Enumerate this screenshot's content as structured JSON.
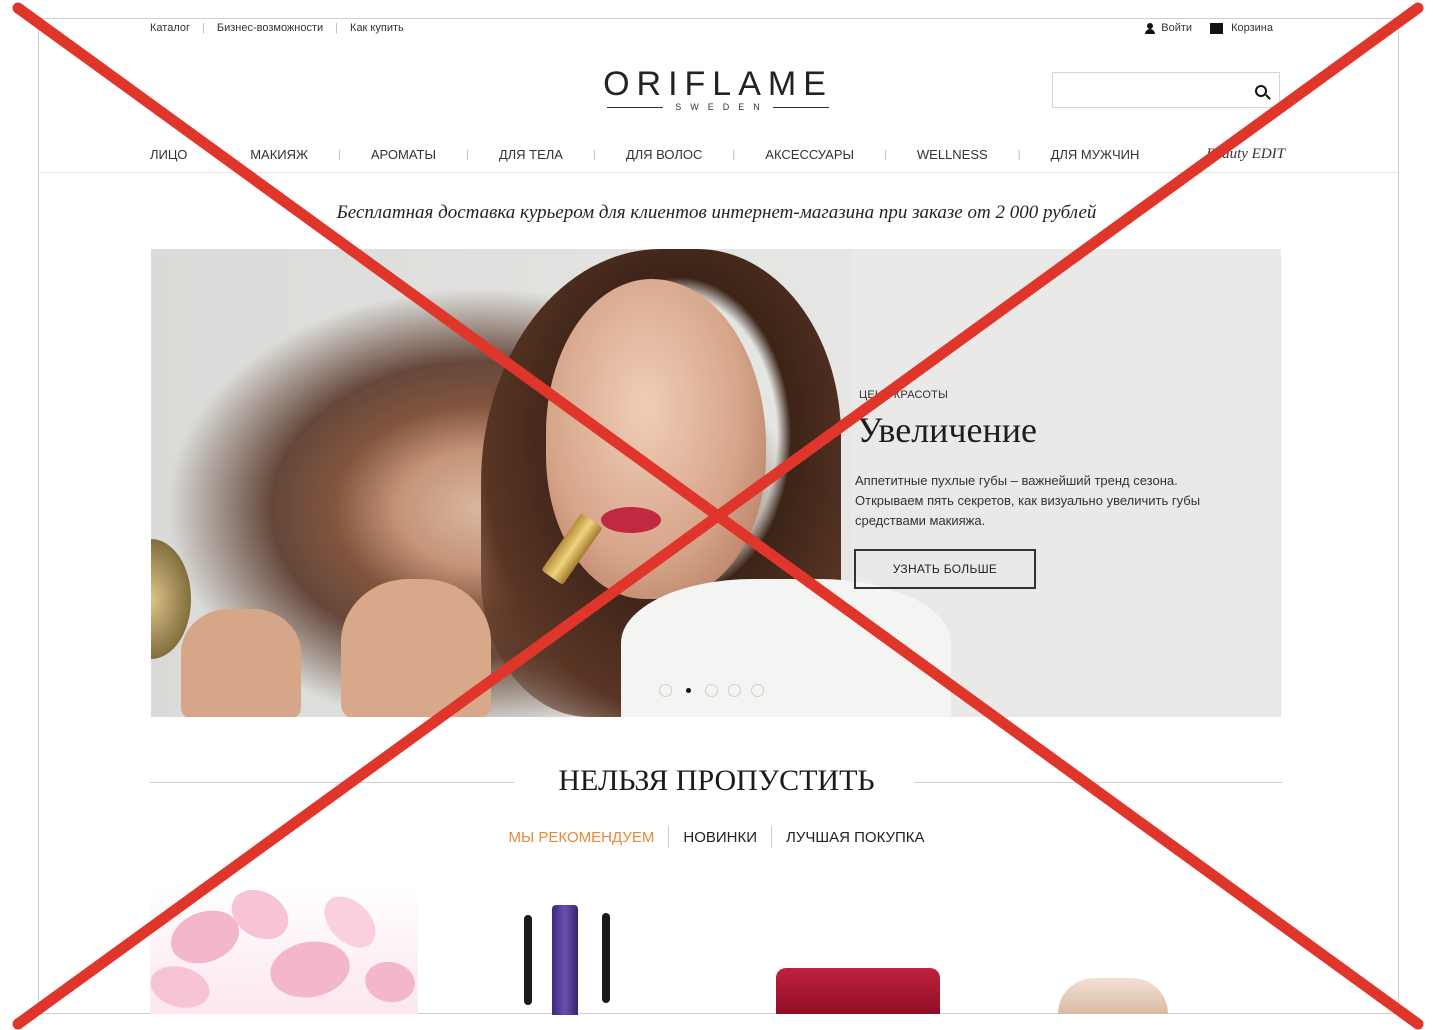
{
  "top_bar": {
    "links": [
      "Каталог",
      "Бизнес-возможности",
      "Как купить"
    ],
    "login_label": "Войти",
    "cart_label": "Корзина"
  },
  "logo": {
    "name": "ORIFLAME",
    "subtitle": "SWEDEN"
  },
  "search": {
    "placeholder": ""
  },
  "nav": {
    "items": [
      "ЛИЦО",
      "МАКИЯЖ",
      "АРОМАТЫ",
      "ДЛЯ ТЕЛА",
      "ДЛЯ ВОЛОС",
      "АКСЕССУАРЫ",
      "WELLNESS",
      "ДЛЯ МУЖЧИН"
    ],
    "edit_label": "Beauty EDIT"
  },
  "promo_text": "Бесплатная доставка курьером для клиентов интернет-магазина при заказе от 2 000 рублей",
  "hero": {
    "eyebrow": "ЦЕНА КРАСОТЫ",
    "title": "Увеличение",
    "description": "Аппетитные пухлые губы – важнейший тренд сезона. Открываем пять секретов, как визуально увеличить губы средствами макияжа.",
    "cta": "УЗНАТЬ БОЛЬШЕ",
    "slides_count": 5,
    "active_slide": 2
  },
  "section": {
    "title": "НЕЛЬЗЯ ПРОПУСТИТЬ",
    "tabs": [
      "МЫ РЕКОМЕНДУЕМ",
      "НОВИНКИ",
      "ЛУЧШАЯ ПОКУПКА"
    ],
    "active_tab": 0
  },
  "colors": {
    "accent": "#e28b3a",
    "cross": "#e0352b"
  }
}
